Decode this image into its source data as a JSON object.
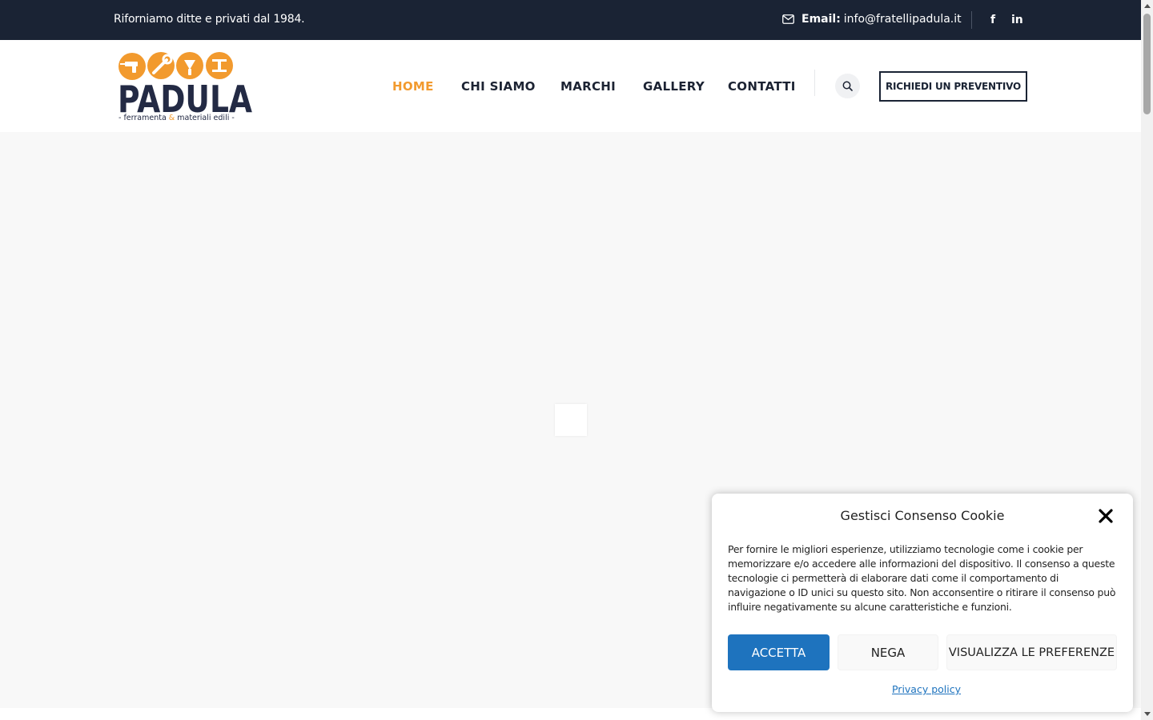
{
  "topbar": {
    "tagline": "Riforniamo ditte e privati dal 1984.",
    "email_label": "Email:",
    "email_value": "info@fratellipadula.it",
    "social": {
      "facebook": "f",
      "linkedin": "in"
    }
  },
  "logo": {
    "name": "PADULA",
    "tagline_left": "- ferramenta ",
    "tagline_amp": "&",
    "tagline_right": " materiali edili -"
  },
  "nav": {
    "items": [
      {
        "label": "HOME",
        "active": true
      },
      {
        "label": "CHI SIAMO",
        "active": false
      },
      {
        "label": "MARCHI",
        "active": false
      },
      {
        "label": "GALLERY",
        "active": false
      },
      {
        "label": "CONTATTI",
        "active": false
      }
    ],
    "cta_label": "RICHIEDI UN PREVENTIVO"
  },
  "cookie": {
    "title": "Gestisci Consenso Cookie",
    "text": "Per fornire le migliori esperienze, utilizziamo tecnologie come i cookie per memorizzare e/o accedere alle informazioni del dispositivo. Il consenso a queste tecnologie ci permetterà di elaborare dati come il comportamento di navigazione o ID unici su questo sito. Non acconsentire o ritirare il consenso può influire negativamente su alcune caratteristiche e funzioni.",
    "accept_label": "ACCETTA",
    "deny_label": "NEGA",
    "preferences_label": "VISUALIZZA LE PREFERENZE",
    "privacy_label": "Privacy policy"
  },
  "colors": {
    "topbar_bg": "#1a2334",
    "accent": "#f29a2e",
    "accept_button": "#1e73be",
    "page_bg": "#f8f8f8"
  },
  "icons": [
    "envelope-icon",
    "facebook-icon",
    "linkedin-icon",
    "search-icon",
    "close-icon",
    "drill-icon",
    "wrench-icon",
    "trowel-icon",
    "beam-icon"
  ]
}
